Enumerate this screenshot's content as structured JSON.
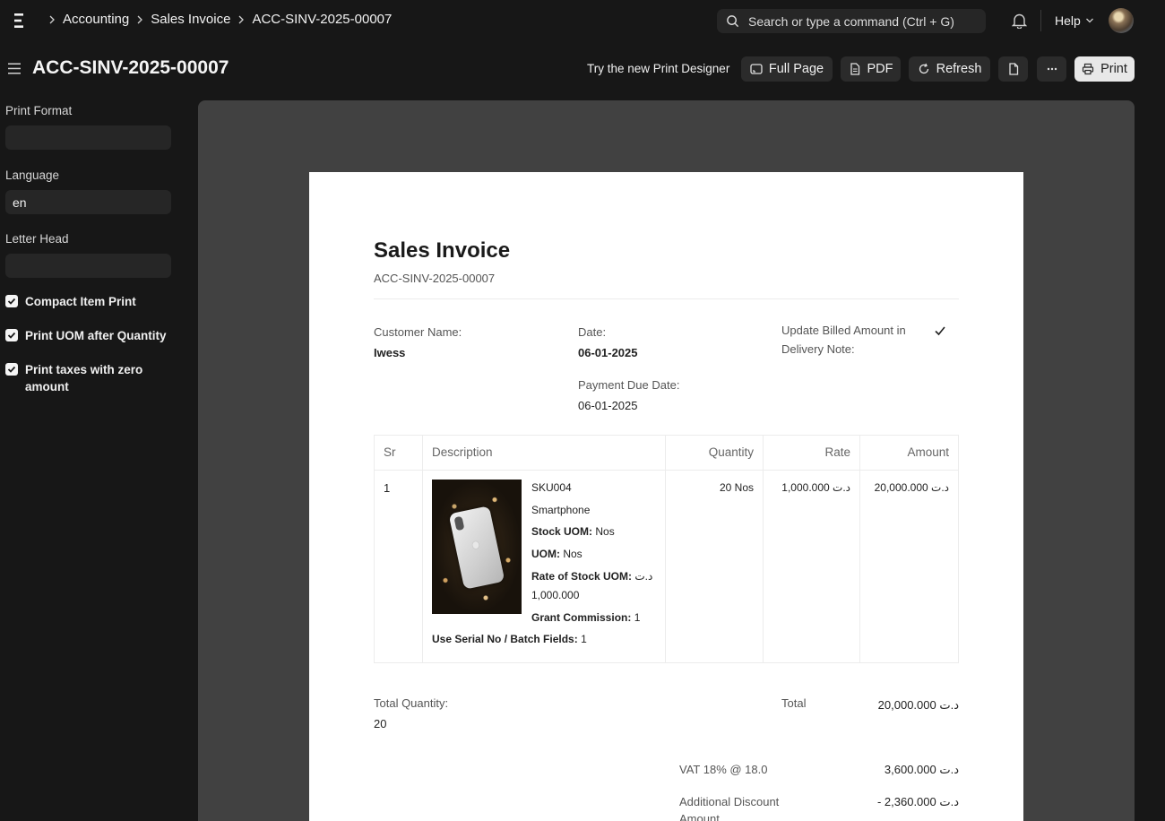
{
  "navbar": {
    "breadcrumbs": [
      "Accounting",
      "Sales Invoice",
      "ACC-SINV-2025-00007"
    ],
    "search_placeholder": "Search or type a command (Ctrl + G)",
    "help_label": "Help"
  },
  "header": {
    "title": "ACC-SINV-2025-00007",
    "print_designer_link": "Try the new Print Designer",
    "full_page_label": "Full Page",
    "pdf_label": "PDF",
    "refresh_label": "Refresh",
    "more_label": "···",
    "print_label": "Print"
  },
  "sidebar": {
    "print_format_label": "Print Format",
    "print_format_value": "",
    "language_label": "Language",
    "language_value": "en",
    "letter_head_label": "Letter Head",
    "letter_head_value": "",
    "options": [
      {
        "label": "Compact Item Print",
        "checked": true
      },
      {
        "label": "Print UOM after Quantity",
        "checked": true
      },
      {
        "label": "Print taxes with zero amount",
        "checked": true
      }
    ]
  },
  "invoice": {
    "title": "Sales Invoice",
    "name": "ACC-SINV-2025-00007",
    "customer_name_label": "Customer Name:",
    "customer_name": "Iwess",
    "date_label": "Date:",
    "date": "06-01-2025",
    "payment_due_date_label": "Payment Due Date:",
    "payment_due_date": "06-01-2025",
    "update_billed_label_1": "Update Billed Amount in",
    "update_billed_label_2": "Delivery Note:",
    "update_billed_checked": true,
    "table_headers": {
      "sr": "Sr",
      "description": "Description",
      "quantity": "Quantity",
      "rate": "Rate",
      "amount": "Amount"
    },
    "items": [
      {
        "sr": "1",
        "item_code": "SKU004",
        "item_name": "Smartphone",
        "stock_uom_label": "Stock UOM:",
        "stock_uom": "Nos",
        "uom_label": "UOM:",
        "uom": "Nos",
        "rate_stock_uom_label": "Rate of Stock UOM:",
        "rate_stock_uom_currency": "د.ت",
        "rate_stock_uom_value": "1,000.000",
        "grant_commission_label": "Grant Commission:",
        "grant_commission": "1",
        "serial_batch_label": "Use Serial No / Batch Fields:",
        "serial_batch": "1",
        "quantity": "20 Nos",
        "rate": "1,000.000 د.ت",
        "amount": "20,000.000 د.ت"
      }
    ],
    "total_quantity_label": "Total Quantity:",
    "total_quantity": "20",
    "total_label": "Total",
    "total": "20,000.000 د.ت",
    "vat_label": "VAT 18% @ 18.0",
    "vat": "3,600.000 د.ت",
    "discount_label_1": "Additional Discount",
    "discount_label_2": "Amount",
    "discount": "- 2,360.000 د.ت"
  },
  "colors": {
    "background": "#171717",
    "surface": "#262626",
    "preview_bg": "#414141",
    "paper": "#ffffff",
    "print_button": "#e8e8e8"
  }
}
